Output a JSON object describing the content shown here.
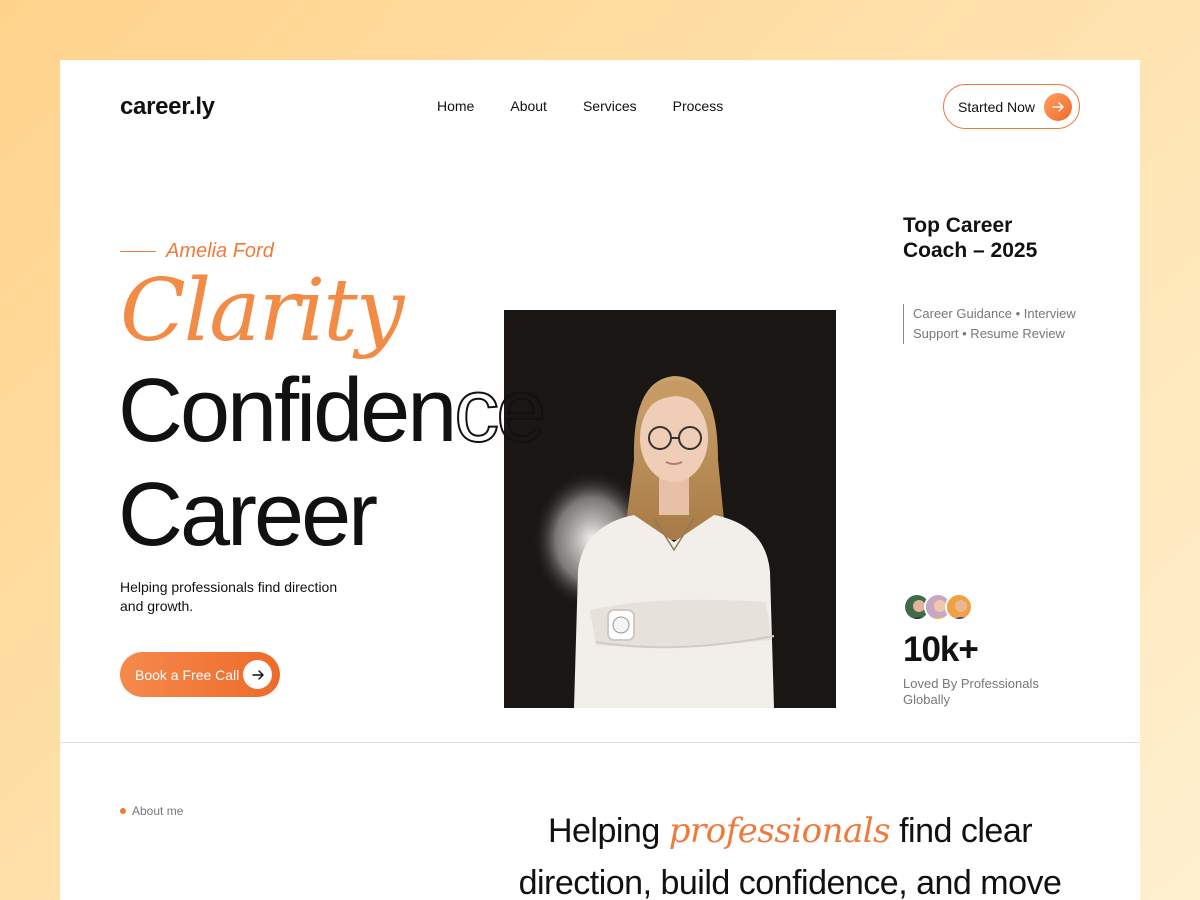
{
  "brand": {
    "logo": "career.ly"
  },
  "nav": {
    "items": [
      "Home",
      "About",
      "Services",
      "Process"
    ]
  },
  "header": {
    "cta_label": "Started Now"
  },
  "hero": {
    "name": "Amelia Ford",
    "line1": "Clarity",
    "line2_solid": "Confiden",
    "line2_outline": "ce",
    "line3": "Career",
    "description": "Helping professionals find direction and growth.",
    "cta_label": "Book a Free Call"
  },
  "sidebar": {
    "award": "Top Career Coach – 2025",
    "services": "Career Guidance • Interview Support • Resume Review",
    "stat_value": "10k+",
    "stat_label": "Loved By Professionals Globally"
  },
  "about": {
    "tag": "About me",
    "heading_before": "Helping ",
    "heading_em": "professionals",
    "heading_after": " find clear direction, build confidence, and move"
  },
  "colors": {
    "accent": "#f07a3c",
    "background_start": "#ffd38c",
    "card": "#ffffff",
    "text": "#111111"
  },
  "icons": {
    "cta_top": "arrow-right-icon",
    "book": "arrow-right-icon"
  }
}
